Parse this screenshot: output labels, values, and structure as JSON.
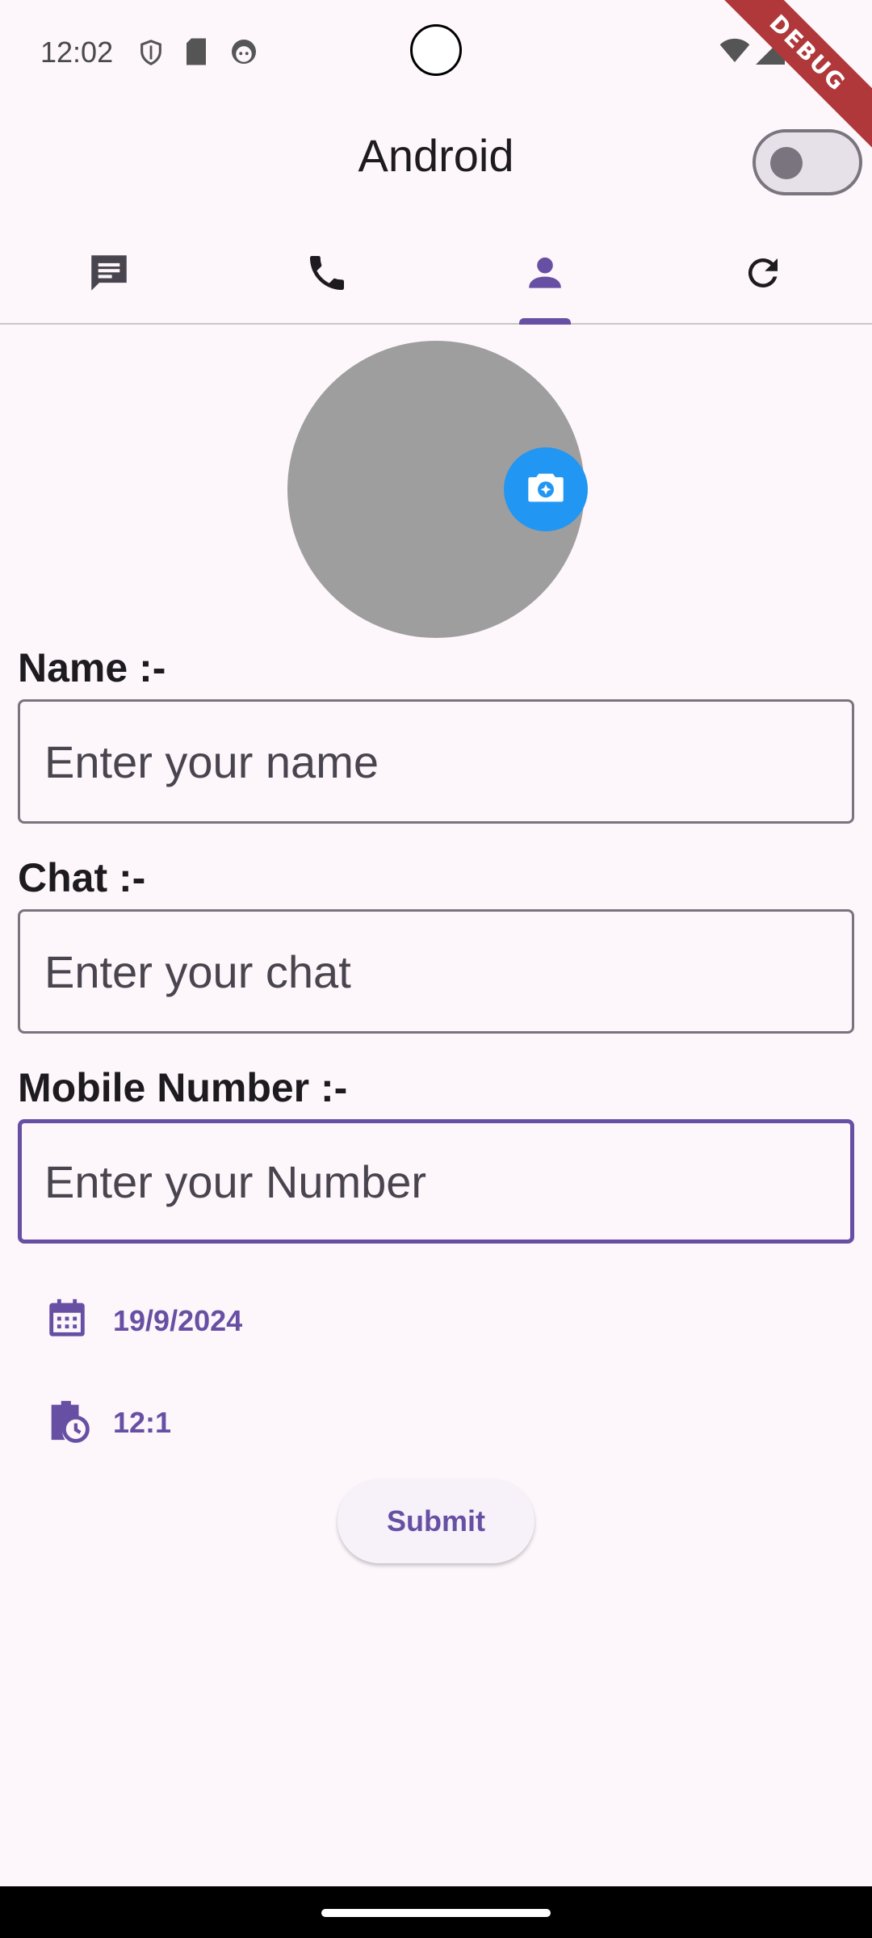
{
  "status_bar": {
    "time": "12:02",
    "icons": [
      "shield-icon",
      "sd-card-icon",
      "face-icon",
      "wifi-icon",
      "signal-icon"
    ]
  },
  "debug_banner": "DEBUG",
  "app_bar": {
    "title": "Android",
    "theme_toggle_on": false
  },
  "tabs": [
    {
      "icon": "message-icon",
      "selected": false
    },
    {
      "icon": "phone-icon",
      "selected": false
    },
    {
      "icon": "person-icon",
      "selected": true
    },
    {
      "icon": "refresh-icon",
      "selected": false
    }
  ],
  "profile": {
    "avatar_color": "#9e9e9e",
    "camera_button_icon": "camera-icon",
    "camera_button_color": "#2196f3"
  },
  "form": {
    "name_label": "Name :-",
    "name_placeholder": "Enter your name",
    "name_value": "",
    "chat_label": "Chat :-",
    "chat_placeholder": "Enter your chat",
    "chat_value": "",
    "mobile_label": "Mobile Number :-",
    "mobile_placeholder": "Enter your Number",
    "mobile_value": ""
  },
  "date_picker": {
    "icon": "calendar-icon",
    "value": "19/9/2024"
  },
  "time_picker": {
    "icon": "clock-icon",
    "value": "12:1"
  },
  "submit_label": "Submit",
  "colors": {
    "background": "#fdf7fc",
    "primary": "#6750a4",
    "outline": "#79747e"
  }
}
